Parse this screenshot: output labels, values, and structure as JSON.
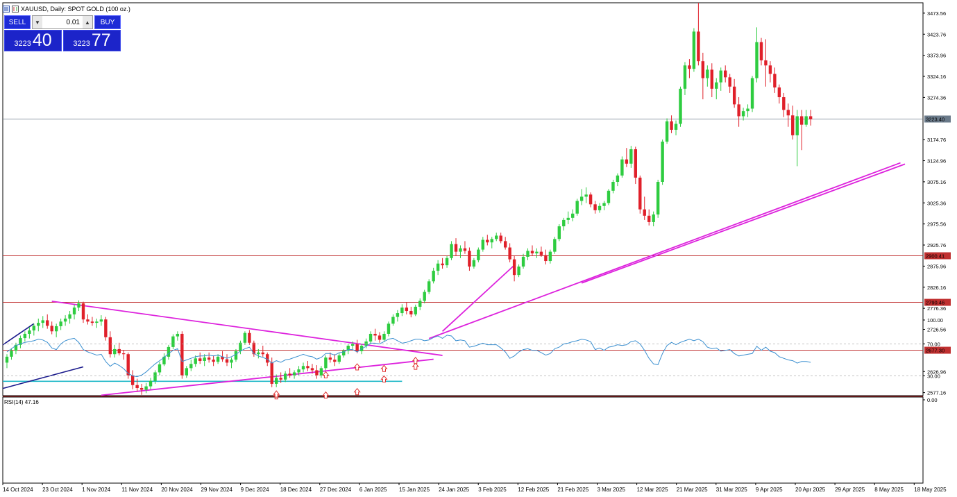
{
  "window": {
    "title": "XAUUSD, Daily:  SPOT GOLD (100 oz.)"
  },
  "trade_panel": {
    "sell_label": "SELL",
    "buy_label": "BUY",
    "lot": "0.01",
    "sell_price_small": "3223",
    "sell_price_big": "40",
    "buy_price_small": "3223",
    "buy_price_big": "77"
  },
  "colors": {
    "bull": "#2ecc40",
    "bear": "#e0202a",
    "trendline": "#dd22dd",
    "support": "#c03030",
    "blue_channel": "#1a1a8c",
    "cyan_line": "#20b8c8",
    "rsi_line": "#3a8fd0",
    "arrow": "#e03030"
  },
  "chart_data": {
    "type": "candlestick",
    "symbol": "XAUUSD",
    "timeframe": "Daily",
    "yticks": [
      "3473.56",
      "3423.76",
      "3373.96",
      "3324.16",
      "3274.36",
      "3223.40",
      "3174.76",
      "3124.96",
      "3075.16",
      "3025.36",
      "2975.56",
      "2925.76",
      "2900.41",
      "2875.96",
      "2826.16",
      "2790.46",
      "2776.36",
      "2726.56",
      "2677.30",
      "2626.96",
      "2577.16"
    ],
    "current_price": 3223.4,
    "ylim": [
      2570,
      3498
    ],
    "horizontal_levels": [
      {
        "value": 2900.41,
        "label": "2900.41"
      },
      {
        "value": 2790.46,
        "label": "2790.46"
      },
      {
        "value": 2677.3,
        "label": "2677.30"
      }
    ],
    "x_labels": [
      "14 Oct 2024",
      "23 Oct 2024",
      "1 Nov 2024",
      "11 Nov 2024",
      "20 Nov 2024",
      "29 Nov 2024",
      "9 Dec 2024",
      "18 Dec 2024",
      "27 Dec 2024",
      "6 Jan 2025",
      "15 Jan 2025",
      "24 Jan 2025",
      "3 Feb 2025",
      "12 Feb 2025",
      "21 Feb 2025",
      "3 Mar 2025",
      "12 Mar 2025",
      "21 Mar 2025",
      "31 Mar 2025",
      "9 Apr 2025",
      "20 Apr 2025",
      "29 Apr 2025",
      "8 May 2025",
      "18 May 2025"
    ],
    "candles": [
      [
        2648,
        2668,
        2635,
        2662
      ],
      [
        2662,
        2682,
        2655,
        2676
      ],
      [
        2676,
        2695,
        2668,
        2690
      ],
      [
        2690,
        2712,
        2682,
        2706
      ],
      [
        2706,
        2722,
        2698,
        2716
      ],
      [
        2716,
        2732,
        2705,
        2724
      ],
      [
        2724,
        2740,
        2712,
        2735
      ],
      [
        2735,
        2752,
        2722,
        2742
      ],
      [
        2742,
        2758,
        2730,
        2748
      ],
      [
        2748,
        2762,
        2728,
        2735
      ],
      [
        2735,
        2745,
        2715,
        2722
      ],
      [
        2722,
        2740,
        2708,
        2734
      ],
      [
        2734,
        2752,
        2725,
        2745
      ],
      [
        2745,
        2760,
        2735,
        2752
      ],
      [
        2752,
        2770,
        2740,
        2762
      ],
      [
        2762,
        2785,
        2750,
        2778
      ],
      [
        2778,
        2795,
        2770,
        2788
      ],
      [
        2788,
        2792,
        2742,
        2750
      ],
      [
        2750,
        2762,
        2738,
        2745
      ],
      [
        2745,
        2756,
        2735,
        2742
      ],
      [
        2742,
        2752,
        2730,
        2745
      ],
      [
        2745,
        2760,
        2735,
        2750
      ],
      [
        2750,
        2756,
        2700,
        2708
      ],
      [
        2708,
        2722,
        2660,
        2668
      ],
      [
        2668,
        2690,
        2660,
        2680
      ],
      [
        2680,
        2695,
        2665,
        2670
      ],
      [
        2670,
        2678,
        2655,
        2668
      ],
      [
        2668,
        2672,
        2610,
        2618
      ],
      [
        2618,
        2630,
        2585,
        2595
      ],
      [
        2595,
        2610,
        2580,
        2588
      ],
      [
        2588,
        2598,
        2572,
        2584
      ],
      [
        2584,
        2600,
        2576,
        2592
      ],
      [
        2592,
        2612,
        2585,
        2605
      ],
      [
        2605,
        2630,
        2598,
        2625
      ],
      [
        2625,
        2650,
        2618,
        2644
      ],
      [
        2644,
        2670,
        2640,
        2662
      ],
      [
        2662,
        2690,
        2655,
        2685
      ],
      [
        2685,
        2715,
        2680,
        2710
      ],
      [
        2710,
        2722,
        2700,
        2716
      ],
      [
        2716,
        2722,
        2610,
        2618
      ],
      [
        2618,
        2640,
        2612,
        2635
      ],
      [
        2635,
        2655,
        2628,
        2645
      ],
      [
        2645,
        2665,
        2638,
        2658
      ],
      [
        2658,
        2672,
        2645,
        2652
      ],
      [
        2652,
        2668,
        2640,
        2660
      ],
      [
        2660,
        2672,
        2648,
        2655
      ],
      [
        2655,
        2665,
        2640,
        2650
      ],
      [
        2650,
        2668,
        2645,
        2662
      ],
      [
        2662,
        2675,
        2650,
        2656
      ],
      [
        2656,
        2668,
        2640,
        2648
      ],
      [
        2648,
        2660,
        2635,
        2655
      ],
      [
        2655,
        2680,
        2650,
        2675
      ],
      [
        2675,
        2700,
        2668,
        2695
      ],
      [
        2695,
        2722,
        2690,
        2718
      ],
      [
        2718,
        2725,
        2690,
        2695
      ],
      [
        2695,
        2700,
        2662,
        2668
      ],
      [
        2668,
        2680,
        2658,
        2672
      ],
      [
        2672,
        2688,
        2662,
        2668
      ],
      [
        2668,
        2672,
        2640,
        2648
      ],
      [
        2648,
        2660,
        2590,
        2598
      ],
      [
        2598,
        2620,
        2590,
        2612
      ],
      [
        2612,
        2625,
        2600,
        2608
      ],
      [
        2608,
        2628,
        2602,
        2622
      ],
      [
        2622,
        2635,
        2612,
        2618
      ],
      [
        2618,
        2630,
        2610,
        2625
      ],
      [
        2625,
        2640,
        2618,
        2632
      ],
      [
        2632,
        2648,
        2625,
        2640
      ],
      [
        2640,
        2652,
        2628,
        2635
      ],
      [
        2635,
        2645,
        2622,
        2630
      ],
      [
        2630,
        2642,
        2610,
        2618
      ],
      [
        2618,
        2640,
        2612,
        2635
      ],
      [
        2635,
        2665,
        2630,
        2660
      ],
      [
        2660,
        2672,
        2648,
        2655
      ],
      [
        2655,
        2668,
        2640,
        2650
      ],
      [
        2650,
        2670,
        2645,
        2665
      ],
      [
        2665,
        2680,
        2660,
        2676
      ],
      [
        2676,
        2692,
        2668,
        2688
      ],
      [
        2688,
        2698,
        2680,
        2692
      ],
      [
        2692,
        2702,
        2670,
        2675
      ],
      [
        2675,
        2692,
        2668,
        2688
      ],
      [
        2688,
        2705,
        2682,
        2698
      ],
      [
        2698,
        2722,
        2692,
        2716
      ],
      [
        2716,
        2728,
        2700,
        2712
      ],
      [
        2712,
        2720,
        2695,
        2702
      ],
      [
        2702,
        2722,
        2698,
        2716
      ],
      [
        2716,
        2745,
        2710,
        2740
      ],
      [
        2740,
        2762,
        2735,
        2756
      ],
      [
        2756,
        2772,
        2745,
        2765
      ],
      [
        2765,
        2786,
        2758,
        2778
      ],
      [
        2778,
        2790,
        2762,
        2770
      ],
      [
        2770,
        2780,
        2755,
        2762
      ],
      [
        2762,
        2785,
        2758,
        2780
      ],
      [
        2780,
        2800,
        2772,
        2794
      ],
      [
        2794,
        2820,
        2788,
        2815
      ],
      [
        2815,
        2845,
        2810,
        2840
      ],
      [
        2840,
        2872,
        2835,
        2865
      ],
      [
        2865,
        2890,
        2855,
        2882
      ],
      [
        2882,
        2895,
        2870,
        2878
      ],
      [
        2878,
        2900,
        2872,
        2895
      ],
      [
        2895,
        2935,
        2890,
        2928
      ],
      [
        2928,
        2942,
        2900,
        2910
      ],
      [
        2910,
        2925,
        2895,
        2918
      ],
      [
        2918,
        2935,
        2905,
        2912
      ],
      [
        2912,
        2920,
        2865,
        2875
      ],
      [
        2875,
        2895,
        2870,
        2890
      ],
      [
        2890,
        2920,
        2885,
        2915
      ],
      [
        2915,
        2945,
        2910,
        2938
      ],
      [
        2938,
        2950,
        2925,
        2932
      ],
      [
        2932,
        2945,
        2918,
        2940
      ],
      [
        2940,
        2955,
        2935,
        2948
      ],
      [
        2948,
        2955,
        2930,
        2935
      ],
      [
        2935,
        2945,
        2915,
        2920
      ],
      [
        2920,
        2930,
        2885,
        2892
      ],
      [
        2892,
        2900,
        2840,
        2855
      ],
      [
        2855,
        2880,
        2850,
        2875
      ],
      [
        2875,
        2905,
        2870,
        2898
      ],
      [
        2898,
        2918,
        2890,
        2912
      ],
      [
        2912,
        2925,
        2900,
        2906
      ],
      [
        2906,
        2918,
        2895,
        2910
      ],
      [
        2910,
        2922,
        2898,
        2902
      ],
      [
        2902,
        2915,
        2880,
        2888
      ],
      [
        2888,
        2915,
        2882,
        2910
      ],
      [
        2910,
        2945,
        2905,
        2940
      ],
      [
        2940,
        2975,
        2935,
        2970
      ],
      [
        2970,
        2990,
        2960,
        2985
      ],
      [
        2985,
        3005,
        2975,
        2990
      ],
      [
        2990,
        3010,
        2982,
        3000
      ],
      [
        3000,
        3035,
        2995,
        3030
      ],
      [
        3030,
        3058,
        3020,
        3040
      ],
      [
        3040,
        3062,
        3025,
        3045
      ],
      [
        3045,
        3050,
        3015,
        3022
      ],
      [
        3022,
        3030,
        3000,
        3008
      ],
      [
        3008,
        3025,
        3002,
        3018
      ],
      [
        3018,
        3030,
        3008,
        3025
      ],
      [
        3025,
        3058,
        3020,
        3054
      ],
      [
        3054,
        3080,
        3048,
        3075
      ],
      [
        3075,
        3095,
        3065,
        3090
      ],
      [
        3090,
        3135,
        3085,
        3128
      ],
      [
        3128,
        3155,
        3110,
        3118
      ],
      [
        3118,
        3160,
        3108,
        3152
      ],
      [
        3152,
        3158,
        3070,
        3085
      ],
      [
        3085,
        3090,
        3000,
        3010
      ],
      [
        3010,
        3040,
        2985,
        2995
      ],
      [
        2995,
        3010,
        2972,
        2980
      ],
      [
        2980,
        3005,
        2970,
        2998
      ],
      [
        2998,
        3080,
        2990,
        3075
      ],
      [
        3075,
        3175,
        3068,
        3170
      ],
      [
        3170,
        3225,
        3165,
        3218
      ],
      [
        3218,
        3232,
        3190,
        3198
      ],
      [
        3198,
        3220,
        3185,
        3212
      ],
      [
        3212,
        3300,
        3205,
        3295
      ],
      [
        3295,
        3358,
        3280,
        3350
      ],
      [
        3350,
        3365,
        3320,
        3342
      ],
      [
        3342,
        3438,
        3335,
        3430
      ],
      [
        3430,
        3498,
        3350,
        3360
      ],
      [
        3360,
        3380,
        3270,
        3320
      ],
      [
        3320,
        3350,
        3300,
        3340
      ],
      [
        3340,
        3355,
        3275,
        3295
      ],
      [
        3295,
        3320,
        3270,
        3310
      ],
      [
        3310,
        3345,
        3290,
        3338
      ],
      [
        3338,
        3350,
        3310,
        3322
      ],
      [
        3322,
        3330,
        3285,
        3300
      ],
      [
        3300,
        3318,
        3250,
        3258
      ],
      [
        3258,
        3275,
        3205,
        3230
      ],
      [
        3230,
        3250,
        3220,
        3242
      ],
      [
        3242,
        3258,
        3228,
        3248
      ],
      [
        3248,
        3325,
        3240,
        3320
      ],
      [
        3320,
        3440,
        3310,
        3405
      ],
      [
        3405,
        3415,
        3350,
        3362
      ],
      [
        3362,
        3412,
        3300,
        3350
      ],
      [
        3350,
        3360,
        3310,
        3330
      ],
      [
        3330,
        3345,
        3285,
        3298
      ],
      [
        3298,
        3305,
        3260,
        3275
      ],
      [
        3275,
        3285,
        3228,
        3245
      ],
      [
        3245,
        3260,
        3205,
        3232
      ],
      [
        3232,
        3255,
        3175,
        3185
      ],
      [
        3185,
        3245,
        3112,
        3230
      ],
      [
        3230,
        3245,
        3150,
        3210
      ],
      [
        3210,
        3245,
        3205,
        3230
      ],
      [
        3230,
        3245,
        3208,
        3223
      ]
    ]
  },
  "rsi": {
    "title": "RSI(14) 47.16",
    "yticks": [
      "100.00",
      "70.00",
      "30.00",
      "0.00"
    ],
    "values": [
      60,
      64,
      68,
      70,
      72,
      73,
      74,
      76,
      75,
      72,
      65,
      63,
      70,
      74,
      76,
      77,
      72,
      63,
      60,
      58,
      56,
      57,
      48,
      42,
      46,
      43,
      39,
      33,
      30,
      29,
      31,
      35,
      40,
      45,
      49,
      53,
      58,
      62,
      64,
      48,
      50,
      52,
      54,
      55,
      55,
      56,
      55,
      56,
      54,
      52,
      54,
      57,
      61,
      64,
      66,
      58,
      55,
      53,
      51,
      46,
      49,
      47,
      50,
      51,
      53,
      55,
      57,
      55,
      54,
      51,
      53,
      58,
      58,
      56,
      59,
      60,
      63,
      63,
      60,
      64,
      67,
      71,
      71,
      70,
      73,
      76,
      77,
      74,
      71,
      72,
      74,
      76,
      76,
      74,
      75,
      78,
      80,
      77,
      81,
      80,
      74,
      75,
      74,
      66,
      67,
      69,
      71,
      69,
      69,
      69,
      65,
      60,
      52,
      55,
      60,
      63,
      64,
      62,
      62,
      59,
      56,
      58,
      64,
      66,
      70,
      71,
      73,
      74,
      76,
      75,
      73,
      63,
      65,
      62,
      66,
      67,
      69,
      68,
      69,
      73,
      74,
      70,
      62,
      52,
      45,
      44,
      58,
      68,
      72,
      69,
      72,
      74,
      76,
      74,
      76,
      73,
      66,
      64,
      65,
      61,
      62,
      63,
      58,
      55,
      56,
      57,
      58,
      67,
      62,
      66,
      61,
      59,
      54,
      52,
      50,
      49,
      46,
      48,
      48,
      47
    ],
    "levels": [
      70,
      30
    ]
  }
}
